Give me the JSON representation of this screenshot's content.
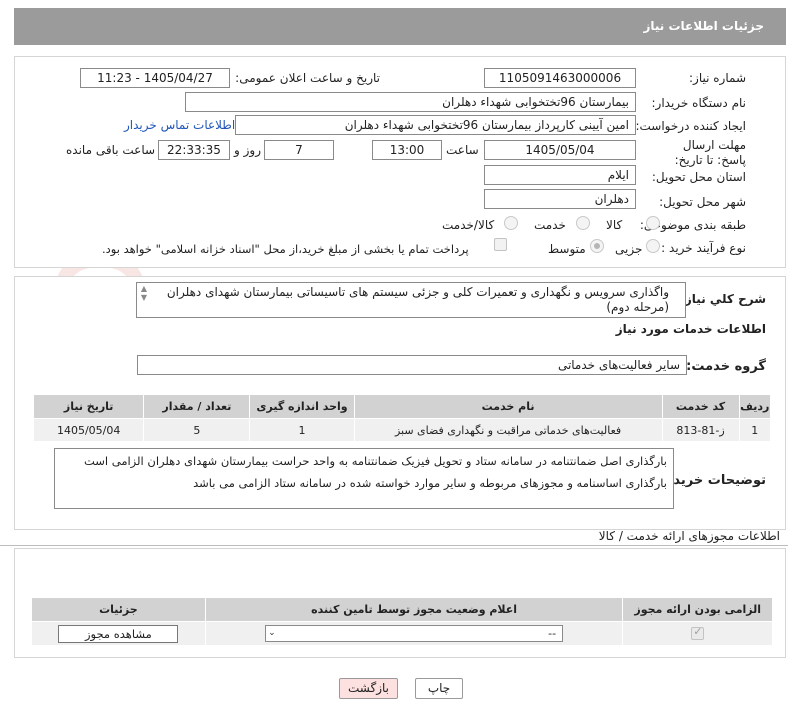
{
  "header": {
    "title": "جزئیات اطلاعات نیاز"
  },
  "fields": {
    "need_number_label": "شماره نیاز:",
    "need_number": "1105091463000006",
    "announce_label": "تاریخ و ساعت اعلان عمومی:",
    "announce_value": "1405/04/27 - 11:23",
    "buyer_org_label": "نام دستگاه خریدار:",
    "buyer_org": "بیمارستان 96تختخوابی شهداء دهلران",
    "creator_label": "ایجاد کننده درخواست:",
    "creator": "امین آیینی کارپرداز بیمارستان 96تختخوابی شهداء دهلران",
    "contact_link": "اطلاعات تماس خریدار",
    "deadline_label": "مهلت ارسال پاسخ: تا تاریخ:",
    "deadline_date": "1405/05/04",
    "time_label": "ساعت",
    "deadline_time": "13:00",
    "days_value": "7",
    "days_label": "روز و",
    "remaining_time": "22:33:35",
    "remaining_label": "ساعت باقی مانده",
    "province_label": "استان محل تحویل:",
    "province": "ایلام",
    "city_label": "شهر محل تحویل:",
    "city": "دهلران",
    "category_label": "طبقه بندی موضوعی:",
    "category_options": [
      "کالا",
      "خدمت",
      "کالا/خدمت"
    ],
    "purchase_type_label": "نوع فرآیند خرید :",
    "purchase_options": [
      "جزیی",
      "متوسط"
    ],
    "payment_note": "پرداخت تمام یا بخشی از مبلغ خرید،از محل \"اسناد خزانه اسلامی\" خواهد بود."
  },
  "summary": {
    "label": "شرح کلي نياز:",
    "text": "واگذاری سرویس و نگهداری و تعمیرات کلی و جزئی سیستم های تاسیساتی بیمارستان شهدای دهلران (مرحله دوم)"
  },
  "services": {
    "section_title": "اطلاعات خدمات مورد نیاز",
    "group_label": "گروه خدمت:",
    "group_value": "سایر فعالیت‌های خدماتی",
    "columns": [
      "ردیف",
      "کد خدمت",
      "نام خدمت",
      "واحد اندازه گیری",
      "تعداد / مقدار",
      "تاریخ نیاز"
    ],
    "rows": [
      [
        "1",
        "ز-81-813",
        "فعالیت‌های خدماتی مراقبت و نگهداری فضای سبز",
        "1",
        "5",
        "1405/05/04"
      ]
    ]
  },
  "buyer_notes": {
    "label": "توضیحات خریدار:",
    "line1": "بارگذاری اصل ضمانتنامه در سامانه ستاد و تحویل فیزیک ضمانتنامه به واحد حراست بیمارستان شهدای دهلران الزامی است",
    "line2": "بارگذاری اساسنامه و مجوزهای مربوطه و سایر موارد خواسته شده در سامانه ستاد الزامی می باشد"
  },
  "permits": {
    "section_title": "اطلاعات مجوزهای ارائه خدمت / کالا",
    "columns": [
      "الزامی بودن ارائه مجوز",
      "اعلام وضعیت مجوز توسط تامین کننده",
      "جزئیات"
    ],
    "select_value": "--",
    "view_button": "مشاهده مجوز"
  },
  "actions": {
    "print": "چاپ",
    "back": "بازگشت"
  },
  "watermark_text": "AriaTender.net"
}
